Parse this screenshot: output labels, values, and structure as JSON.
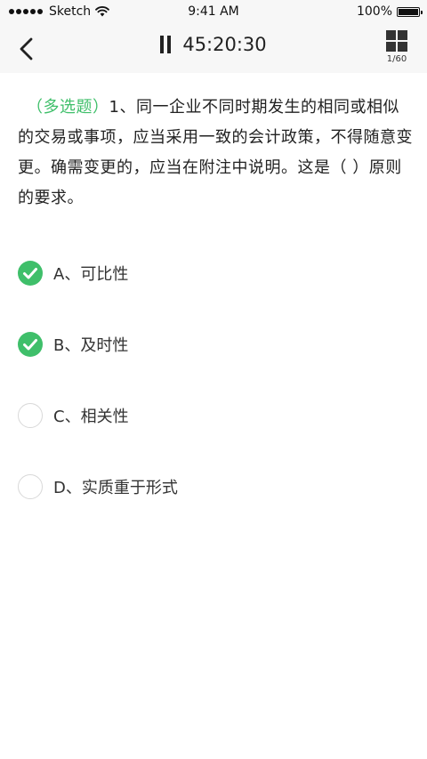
{
  "status_bar": {
    "carrier": "Sketch",
    "time": "9:41 AM",
    "battery": "100%"
  },
  "nav": {
    "timer": "45:20:30",
    "page_counter": "1/60"
  },
  "question": {
    "type_label": "（多选题）",
    "text": "1、同一企业不同时期发生的相同或相似的交易或事项，应当采用一致的会计政策，不得随意变更。确需变更的，应当在附注中说明。这是（ ）原则的要求。"
  },
  "options": [
    {
      "label": "A、可比性",
      "selected": true
    },
    {
      "label": "B、及时性",
      "selected": true
    },
    {
      "label": "C、相关性",
      "selected": false
    },
    {
      "label": "D、实质重于形式",
      "selected": false
    }
  ],
  "colors": {
    "accent": "#3fbf6a",
    "bar_background": "#f7f7f7",
    "unchecked_border": "#d8d8d8"
  },
  "icons": {
    "back": "chevron-left-icon",
    "pause": "pause-icon",
    "grid": "grid-icon",
    "check": "check-icon",
    "wifi": "wifi-icon",
    "battery": "battery-icon"
  }
}
